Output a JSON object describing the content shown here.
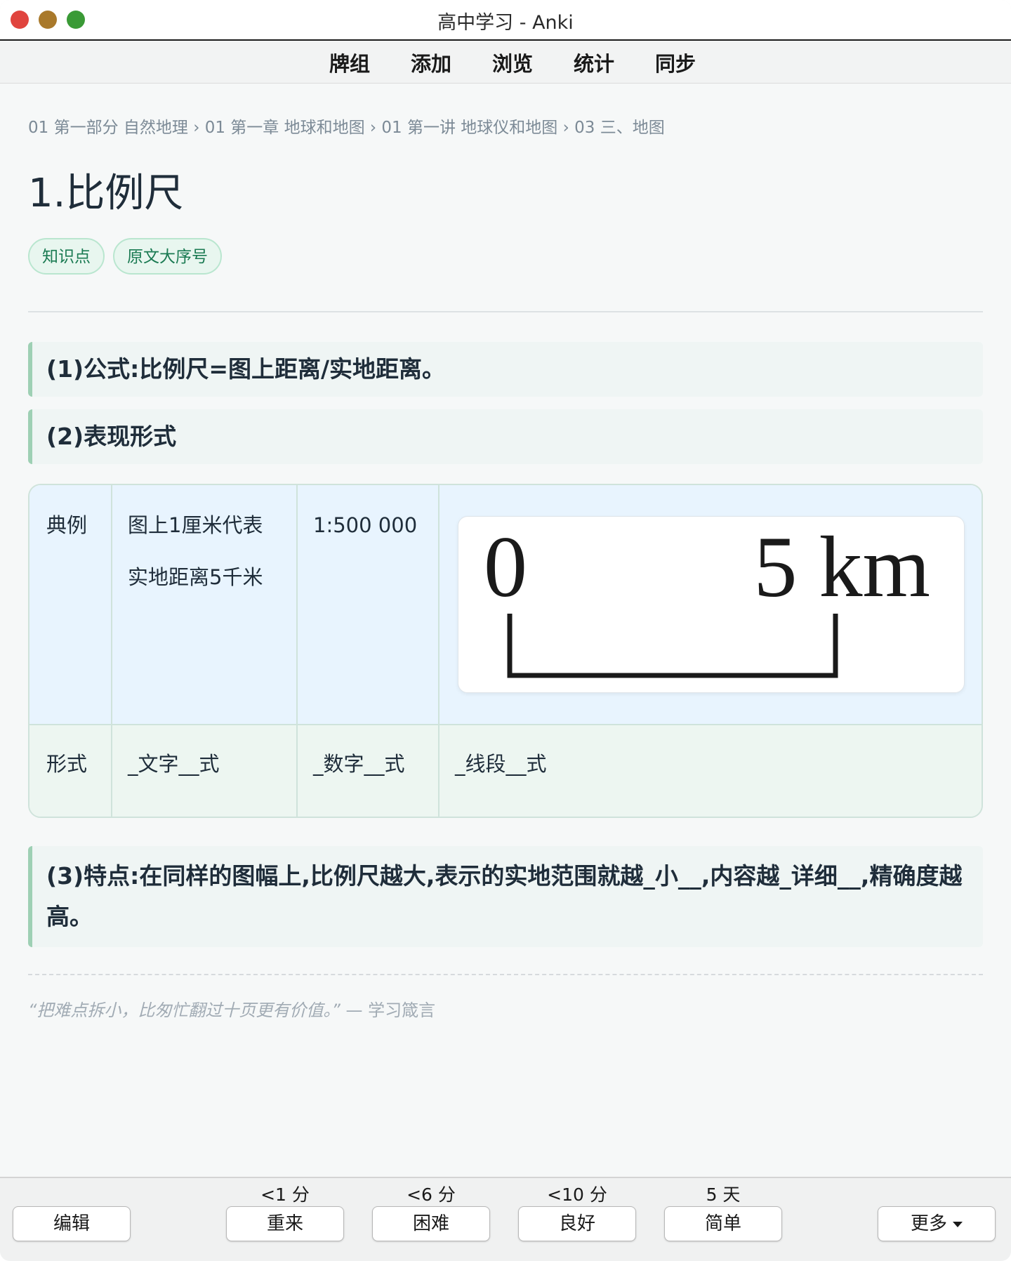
{
  "window": {
    "title": "高中学习 - Anki"
  },
  "menu": {
    "decks": "牌组",
    "add": "添加",
    "browse": "浏览",
    "stats": "统计",
    "sync": "同步"
  },
  "card": {
    "breadcrumb": "01 第一部分 自然地理 › 01 第一章 地球和地图 › 01 第一讲 地球仪和地图 › 03 三、地图",
    "title": "1.比例尺",
    "tags": [
      "知识点",
      "原文大序号"
    ],
    "sections": [
      "(1)公式:比例尺=图上距离/实地距离。",
      "(2)表现形式",
      "(3)特点:在同样的图幅上,比例尺越大,表示的实地范围就越_小__,内容越_详细__,精确度越高。"
    ],
    "table": {
      "row1": {
        "header": "典例",
        "text_line1": "图上1厘米代表",
        "text_line2": "实地距离5千米",
        "numeric": "1:500 000",
        "scale_zero": "0",
        "scale_end": "5 km"
      },
      "row2": {
        "header": "形式",
        "text": "_文字__式",
        "numeric": "_数字__式",
        "line": "_线段__式"
      }
    },
    "quote": {
      "text": "“把难点拆小，比匆忙翻过十页更有价值。”",
      "source": "— 学习箴言"
    }
  },
  "bottom": {
    "edit": "编辑",
    "again": "重来",
    "hard": "困难",
    "good": "良好",
    "easy": "简单",
    "more": "更多",
    "again_interval": "<1 分",
    "hard_interval": "<6 分",
    "good_interval": "<10 分",
    "easy_interval": "5 天"
  },
  "colors": {
    "accent_green": "#9ed0b4",
    "tag_text": "#1a7a52",
    "close_button": "#e0443e",
    "minimize_button": "#a9792b",
    "zoom_button": "#3a9a36"
  }
}
